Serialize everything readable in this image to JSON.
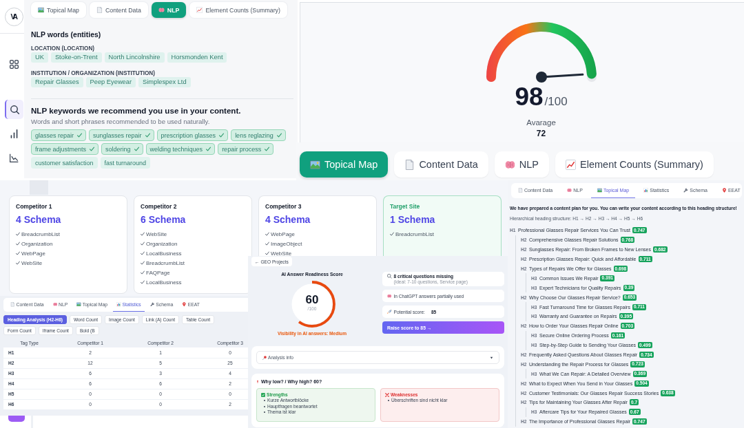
{
  "nlp_panel": {
    "sidebar": {
      "logo": "VA",
      "items": [
        {
          "kind": "grid",
          "selected": false
        },
        {
          "kind": "search",
          "selected": true
        },
        {
          "kind": "bars",
          "selected": false
        },
        {
          "kind": "curve",
          "selected": false
        }
      ]
    },
    "tabs": [
      {
        "kind": "map",
        "label": "Topical Map",
        "selected": false
      },
      {
        "kind": "document",
        "label": "Content Data",
        "selected": false
      },
      {
        "kind": "brain",
        "label": "NLP",
        "selected": true
      },
      {
        "kind": "trend",
        "label": "Element Counts (Summary)",
        "selected": false
      }
    ],
    "entities_title": "NLP words (entities)",
    "entity_groups": [
      {
        "label": "LOCATION (LOCATION)",
        "entities": [
          "UK",
          "Stoke-on-Trent",
          "North Lincolnshire",
          "Horsmonden Kent"
        ]
      },
      {
        "label": "INSTITUTION / ORGANIZATION (INSTITUTION)",
        "entities": [
          "Repair Glasses",
          "Peep Eyewear",
          "Simplespex Ltd"
        ]
      }
    ],
    "keywords_title": "NLP keywords we recommend you use in your content.",
    "keywords_hint": "Words and short phrases recommended to be used naturally.",
    "keywords": [
      {
        "text": "glasses repair",
        "used": true
      },
      {
        "text": "sunglasses repair",
        "used": true
      },
      {
        "text": "prescription glasses",
        "used": true
      },
      {
        "text": "lens reglazing",
        "used": true
      },
      {
        "text": "frame adjustments",
        "used": true
      },
      {
        "text": "soldering",
        "used": true
      },
      {
        "text": "welding techniques",
        "used": true
      },
      {
        "text": "repair process",
        "used": true
      },
      {
        "text": "customer satisfaction",
        "used": false
      },
      {
        "text": "fast turnaround",
        "used": false
      }
    ]
  },
  "score_gauge": {
    "level": 0.98,
    "score": "98",
    "max": "/100",
    "average_label": "Avarage",
    "average": "72"
  },
  "main_tabs": [
    {
      "kind": "map",
      "label": "Topical Map",
      "selected": true
    },
    {
      "kind": "document",
      "label": "Content Data",
      "selected": false
    },
    {
      "kind": "brain",
      "label": "NLP",
      "selected": false
    },
    {
      "kind": "trend",
      "label": "Element Counts (Summary)",
      "selected": false
    }
  ],
  "schema_cards": [
    {
      "kind": "competitor",
      "title": "Competitor 1",
      "count": "4 Schema",
      "types": [
        "BreadcrumbList",
        "Organization",
        "WebPage",
        "WebSite"
      ]
    },
    {
      "kind": "competitor",
      "title": "Competitor 2",
      "count": "6 Schema",
      "types": [
        "WebSite",
        "Organization",
        "LocalBusiness",
        "BreadcrumbList",
        "FAQPage",
        "LocalBusiness"
      ]
    },
    {
      "kind": "competitor",
      "title": "Competitor 3",
      "count": "4 Schema",
      "types": [
        "WebPage",
        "ImageObject",
        "WebSite"
      ]
    },
    {
      "kind": "target",
      "title": "Target Site",
      "count": "1 Schema",
      "types": [
        "BreadcrumbList"
      ]
    }
  ],
  "statistics_panel": {
    "tabs": [
      {
        "kind": "document",
        "label": "Content Data",
        "selected": false
      },
      {
        "kind": "brain",
        "label": "NLP",
        "selected": false
      },
      {
        "kind": "map",
        "label": "Topical Map",
        "selected": false
      },
      {
        "kind": "stats",
        "label": "Statistics",
        "selected": true
      },
      {
        "kind": "wrench",
        "label": "Schema",
        "selected": false
      },
      {
        "kind": "pin",
        "label": "EEAT",
        "selected": false
      }
    ],
    "metric_tabs": [
      {
        "label": "Heading Analysis (H2-H6)",
        "selected": true
      },
      {
        "label": "Word Count",
        "selected": false
      },
      {
        "label": "Image Count",
        "selected": false
      },
      {
        "label": "Link (A) Count",
        "selected": false
      },
      {
        "label": "Table Count",
        "selected": false
      },
      {
        "label": "Form Count",
        "selected": false
      },
      {
        "label": "Iframe Count",
        "selected": false
      },
      {
        "label": "Bold (B",
        "selected": false
      }
    ],
    "table": {
      "columns": [
        "Tag Type",
        "Competitor 1",
        "Competitor 2",
        "Competitor 3"
      ],
      "rows": [
        [
          "H1",
          "2",
          "1",
          "0"
        ],
        [
          "H2",
          "12",
          "5",
          "25"
        ],
        [
          "H3",
          "6",
          "3",
          "4"
        ],
        [
          "H4",
          "6",
          "6",
          "2"
        ],
        [
          "H5",
          "0",
          "0",
          "0"
        ],
        [
          "H6",
          "0",
          "0",
          "2"
        ]
      ]
    }
  },
  "ai_readiness": {
    "back": "← GEO Projects",
    "title": "AI Answer Readiness Score",
    "level": 0.6,
    "score": "60",
    "max": "/100",
    "visibility": "Visibility in AI answers: Medium",
    "facts": [
      {
        "kind": "missing",
        "text": "8 critical questions missing",
        "note": "(ideal: 7-10 questions, Service page)"
      },
      {
        "kind": "usage",
        "text": "In ChatGPT answers partially used"
      },
      {
        "kind": "potential",
        "text": "Potential score:",
        "value": "85"
      }
    ],
    "cta": "Raise score to 85 →",
    "analysis_info": "Analysis info",
    "why": {
      "title": "Why low? / Why high? 60?",
      "strengths_title": "Strengths",
      "strengths": [
        "Kurze Antwortblöcke",
        "Hauptfragen beantwortet",
        "Thema ist klar"
      ],
      "weaknesses_title": "Weaknesses",
      "weaknesses": [
        "Überschriften sind nicht klar"
      ]
    }
  },
  "topical_map_panel": {
    "tabs": [
      {
        "kind": "document",
        "label": "Content Data",
        "selected": false
      },
      {
        "kind": "brain",
        "label": "NLP",
        "selected": false
      },
      {
        "kind": "map",
        "label": "Topical Map",
        "selected": true
      },
      {
        "kind": "stats",
        "label": "Statistics",
        "selected": false
      },
      {
        "kind": "wrench",
        "label": "Schema",
        "selected": false
      },
      {
        "kind": "pin",
        "label": "EEAT",
        "selected": false
      }
    ],
    "intro": "We have prepared a content plan for you. You can write your content according to this heading structure!",
    "structure": "Hierarchical heading structure: H1 → H2 → H3 → H4 → H5 → H6",
    "headings": [
      {
        "tag": "H1",
        "title": "Professional Glasses Repair Services You Can Trust",
        "score": "0.747",
        "children": [
          {
            "tag": "H2",
            "title": "Comprehensive Glasses Repair Solutions",
            "score": "0.768"
          },
          {
            "tag": "H2",
            "title": "Sunglasses Repair: From Broken Frames to New Lenses",
            "score": "0.682"
          },
          {
            "tag": "H2",
            "title": "Prescription Glasses Repair: Quick and Affordable",
            "score": "0.711"
          },
          {
            "tag": "H2",
            "title": "Types of Repairs We Offer for Glasses",
            "score": "0.698",
            "children": [
              {
                "tag": "H3",
                "title": "Common Issues We Repair",
                "score": "0.391"
              },
              {
                "tag": "H3",
                "title": "Expert Technicians for Quality Repairs",
                "score": "0.39"
              }
            ]
          },
          {
            "tag": "H2",
            "title": "Why Choose Our Glasses Repair Service?",
            "score": "0.653",
            "children": [
              {
                "tag": "H3",
                "title": "Fast Turnaround Time for Glasses Repairs",
                "score": "0.711"
              },
              {
                "tag": "H3",
                "title": "Warranty and Guarantee on Repairs",
                "score": "0.395"
              }
            ]
          },
          {
            "tag": "H2",
            "title": "How to Order Your Glasses Repair Online",
            "score": "0.703",
            "children": [
              {
                "tag": "H3",
                "title": "Secure Online Ordering Process",
                "score": "0.161"
              },
              {
                "tag": "H3",
                "title": "Step-by-Step Guide to Sending Your Glasses",
                "score": "0.499"
              }
            ]
          },
          {
            "tag": "H2",
            "title": "Frequently Asked Questions About Glasses Repair",
            "score": "0.734"
          },
          {
            "tag": "H2",
            "title": "Understanding the Repair Process for Glasses",
            "score": "0.723",
            "children": [
              {
                "tag": "H3",
                "title": "What We Can Repair: A Detailed Overview",
                "score": "0.369"
              }
            ]
          },
          {
            "tag": "H2",
            "title": "What to Expect When You Send in Your Glasses",
            "score": "0.504"
          },
          {
            "tag": "H2",
            "title": "Customer Testimonials: Our Glasses Repair Success Stories",
            "score": "0.638"
          },
          {
            "tag": "H2",
            "title": "Tips for Maintaining Your Glasses After Repair",
            "score": "0.7",
            "children": [
              {
                "tag": "H3",
                "title": "Aftercare Tips for Your Repaired Glasses",
                "score": "0.67"
              }
            ]
          },
          {
            "tag": "H2",
            "title": "The Importance of Professional Glasses Repair",
            "score": "0.747"
          }
        ]
      }
    ]
  }
}
